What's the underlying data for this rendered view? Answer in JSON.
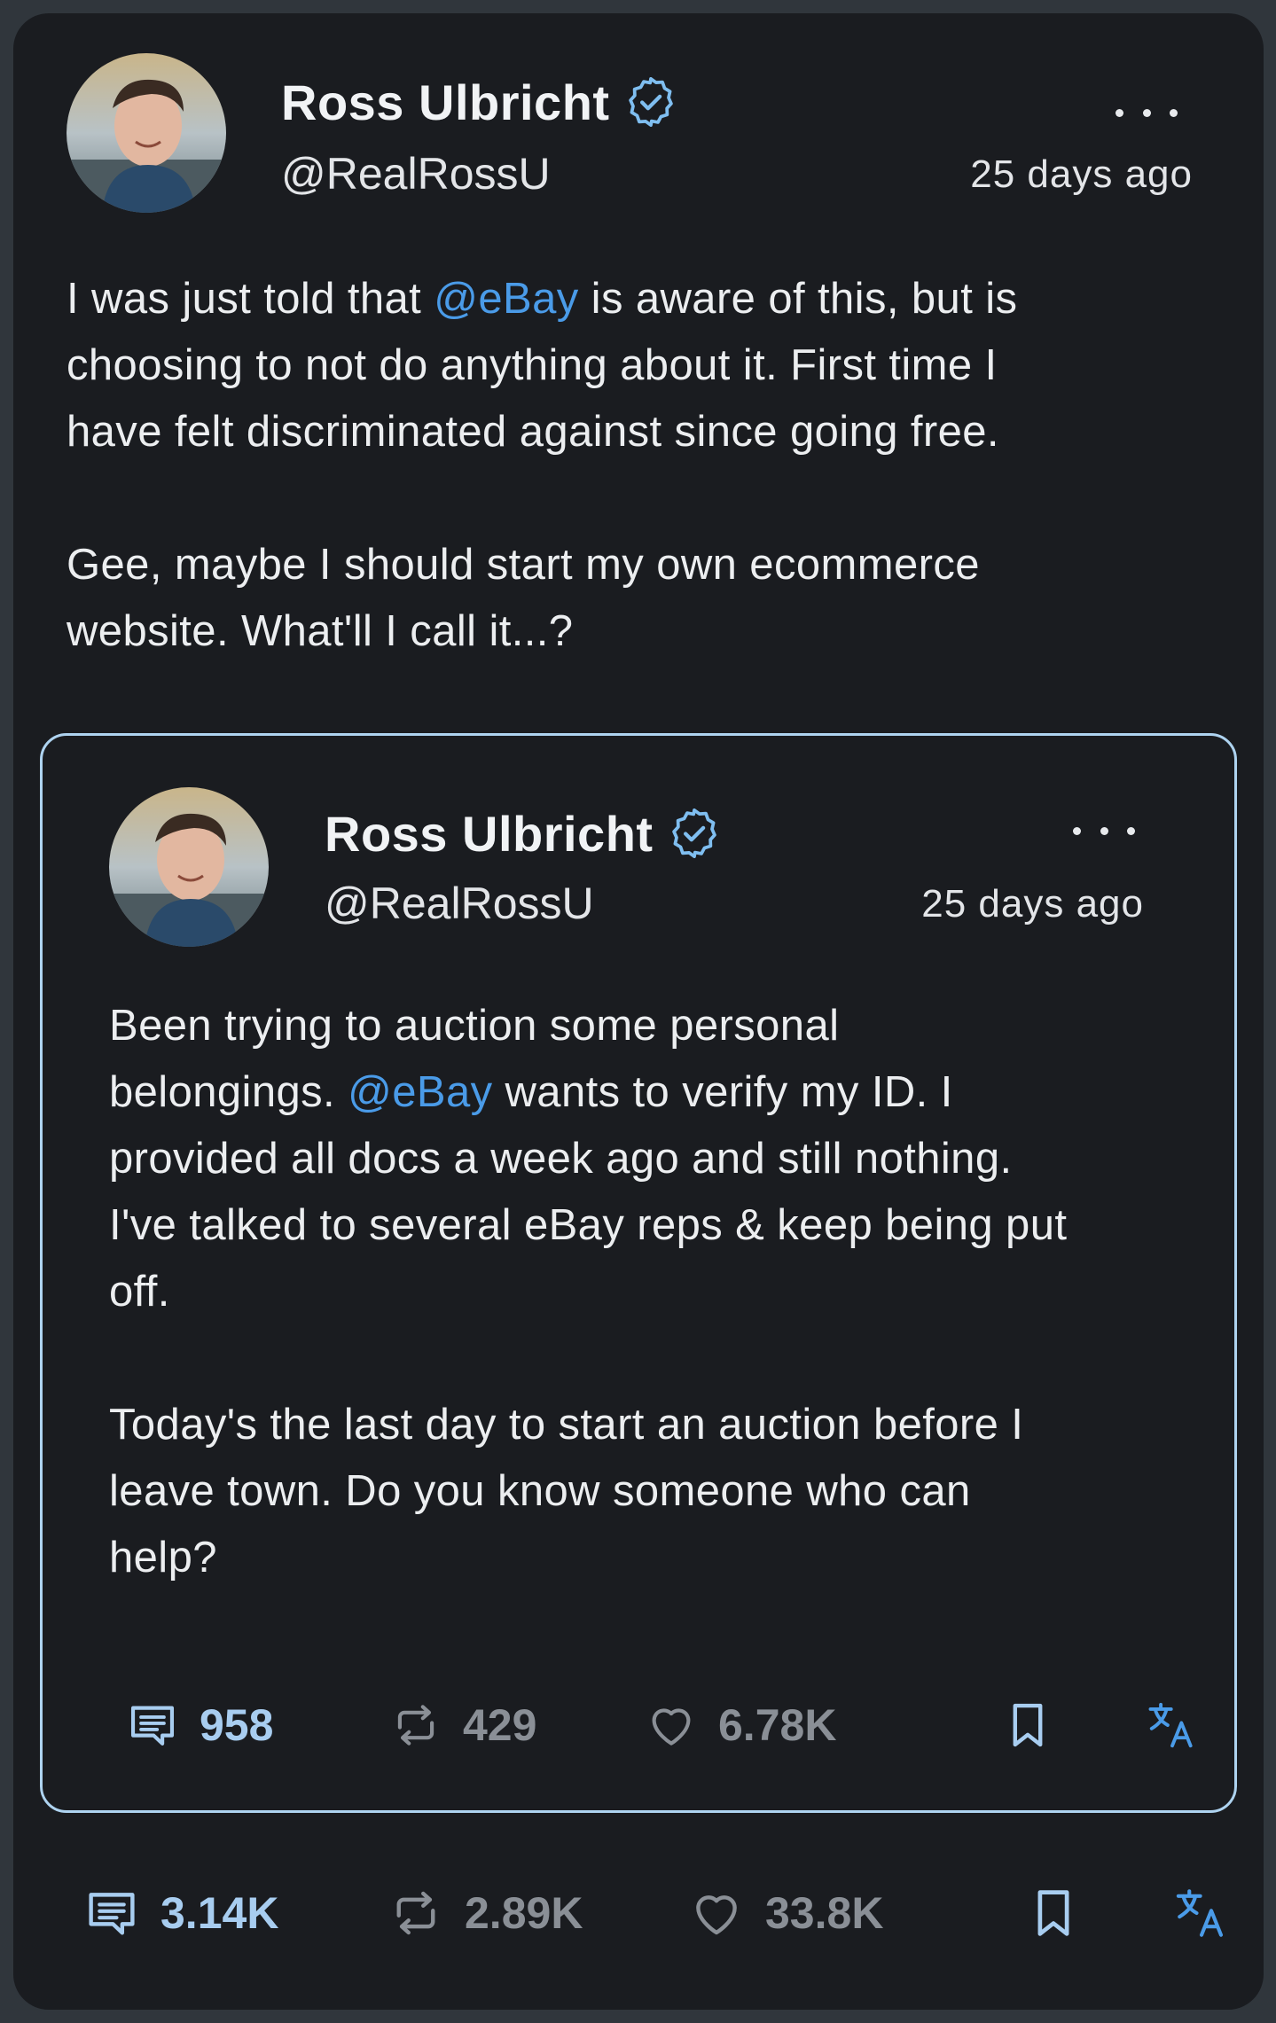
{
  "post": {
    "author": {
      "name": "Ross Ulbricht",
      "handle": "@RealRossU"
    },
    "time": "25 days ago",
    "text_segments": [
      {
        "t": "I was just told that ",
        "mention": false
      },
      {
        "t": "@eBay",
        "mention": true
      },
      {
        "t": " is aware of this, but is\nchoosing to not do anything about it. First time I\nhave felt discriminated against since going free.\n\nGee, maybe I should start my own ecommerce\nwebsite. What'll I call it...?",
        "mention": false
      }
    ],
    "stats": {
      "replies": "3.14K",
      "reposts": "2.89K",
      "likes": "33.8K"
    }
  },
  "quoted": {
    "author": {
      "name": "Ross Ulbricht",
      "handle": "@RealRossU"
    },
    "time": "25 days ago",
    "text_segments": [
      {
        "t": "Been trying to auction some personal\nbelongings. ",
        "mention": false
      },
      {
        "t": "@eBay",
        "mention": true
      },
      {
        "t": " wants to verify my ID. I\nprovided all docs a week ago and still nothing.\nI've talked to several eBay reps & keep being put\noff.\n\nToday's the last day to start an auction before I\nleave town. Do you know someone who can\nhelp?",
        "mention": false
      }
    ],
    "stats": {
      "replies": "958",
      "reposts": "429",
      "likes": "6.78K"
    }
  },
  "icons": {
    "verified": "verified-badge-icon",
    "more": "more-options-icon",
    "reply": "comment-icon",
    "repost": "repost-icon",
    "like": "heart-icon",
    "bookmark": "bookmark-icon",
    "translate": "translate-icon"
  },
  "colors": {
    "background": "#1a1c20",
    "mention": "#4a9be8",
    "accent_border": "#aed3f0",
    "translate": "#4a9be8"
  }
}
